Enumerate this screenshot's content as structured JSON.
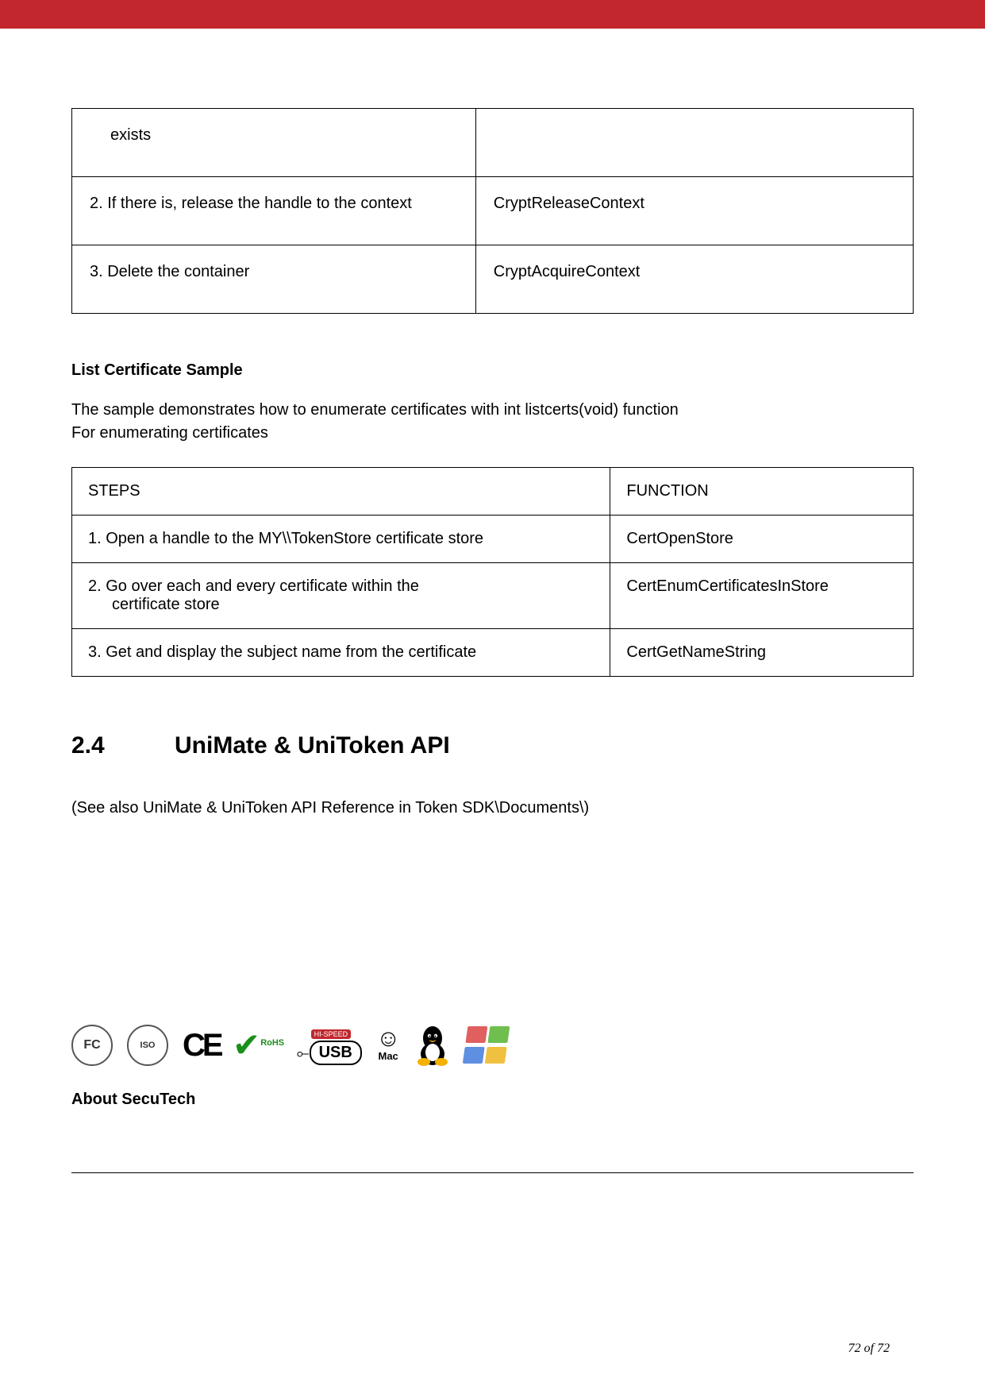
{
  "table1": {
    "rows": [
      {
        "step": "exists",
        "func": ""
      },
      {
        "step": "2. If there is, release the handle to the context",
        "func": "CryptReleaseContext"
      },
      {
        "step": "3. Delete the container",
        "func": "CryptAcquireContext"
      }
    ]
  },
  "subheading1": "List Certificate Sample",
  "paragraph1_line1": "The sample demonstrates how to enumerate certificates with int listcerts(void) function",
  "paragraph1_line2": "For enumerating certificates",
  "table2": {
    "headers": {
      "c1": "STEPS",
      "c2": "FUNCTION"
    },
    "rows": [
      {
        "step": "1. Open a handle to the MY\\\\TokenStore certificate store",
        "func": "CertOpenStore"
      },
      {
        "step_a": "2. Go over each and every certificate within the",
        "step_b": "certificate store",
        "func": "CertEnumCertificatesInStore"
      },
      {
        "step": "3. Get and display the subject name from the certificate",
        "func": "CertGetNameString"
      }
    ]
  },
  "section": {
    "num": "2.4",
    "title": "UniMate & UniToken API"
  },
  "seealso": "(See also UniMate & UniToken API Reference in Token  SDK\\Documents\\)",
  "logos": {
    "fc": "FC",
    "iso": "ISO",
    "ce": "CE",
    "rohs_label": "RoHS",
    "usb_hi": "HI-SPEED",
    "usb": "USB",
    "mac": "Mac"
  },
  "about": "About SecuTech",
  "pagenum": {
    "current": "72",
    "of": "of",
    "total": "72"
  }
}
